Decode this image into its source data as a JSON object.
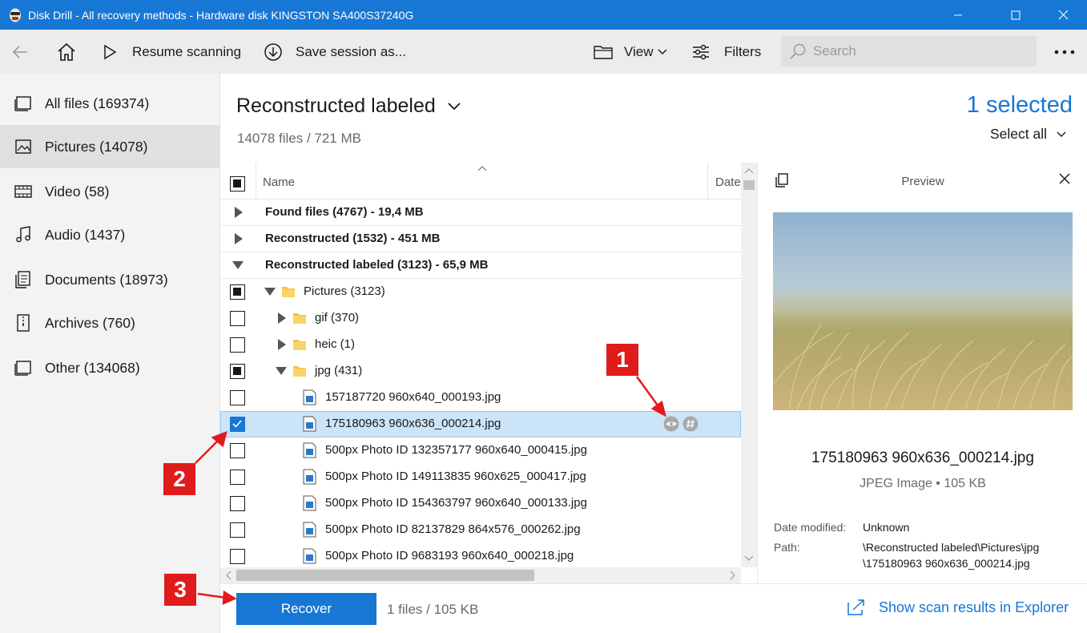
{
  "window": {
    "title": "Disk Drill - All recovery methods - Hardware disk KINGSTON SA400S37240G"
  },
  "toolbar": {
    "resume_label": "Resume scanning",
    "save_label": "Save session as...",
    "view_label": "View",
    "filters_label": "Filters",
    "search_placeholder": "Search"
  },
  "sidebar": {
    "items": [
      {
        "label": "All files (169374)",
        "icon": "all-files-icon"
      },
      {
        "label": "Pictures (14078)",
        "icon": "pictures-icon",
        "active": true
      },
      {
        "label": "Video (58)",
        "icon": "video-icon"
      },
      {
        "label": "Audio (1437)",
        "icon": "audio-icon"
      },
      {
        "label": "Documents (18973)",
        "icon": "documents-icon"
      },
      {
        "label": "Archives (760)",
        "icon": "archives-icon"
      },
      {
        "label": "Other (134068)",
        "icon": "other-icon"
      }
    ]
  },
  "main": {
    "title": "Reconstructed labeled",
    "subtitle": "14078 files / 721 MB",
    "selected_count": "1 selected",
    "select_all": "Select all"
  },
  "table": {
    "columns": {
      "name": "Name",
      "date": "Date"
    },
    "rows": [
      {
        "label": "Found files (4767) - 19,4 MB"
      },
      {
        "label": "Reconstructed (1532) - 451 MB"
      },
      {
        "label": "Reconstructed labeled (3123) - 65,9 MB"
      },
      {
        "label": "Pictures (3123)"
      },
      {
        "label": "gif (370)"
      },
      {
        "label": "heic (1)"
      },
      {
        "label": "jpg (431)"
      },
      {
        "label": "157187720 960x640_000193.jpg"
      },
      {
        "label": "175180963 960x636_000214.jpg"
      },
      {
        "label": "500px Photo ID 132357177 960x640_000415.jpg"
      },
      {
        "label": "500px Photo ID 149113835 960x625_000417.jpg"
      },
      {
        "label": "500px Photo ID 154363797 960x640_000133.jpg"
      },
      {
        "label": "500px Photo ID 82137829 864x576_000262.jpg"
      },
      {
        "label": "500px Photo ID 9683193 960x640_000218.jpg"
      }
    ]
  },
  "preview": {
    "title": "Preview",
    "file_name": "175180963 960x636_000214.jpg",
    "file_type": "JPEG Image • 105 KB",
    "date_label": "Date modified:",
    "date_value": "Unknown",
    "path_label": "Path:",
    "path_line1": "\\Reconstructed labeled\\Pictures\\jpg",
    "path_line2": "\\175180963 960x636_000214.jpg"
  },
  "bottom": {
    "recover_label": "Recover",
    "size_text": "1 files / 105 KB",
    "explorer_label": "Show scan results in Explorer"
  },
  "annotations": {
    "marker1": "1",
    "marker2": "2",
    "marker3": "3"
  },
  "colors": {
    "accent": "#1777d4",
    "selection": "#cce4f7",
    "marker": "#e01b1b"
  }
}
